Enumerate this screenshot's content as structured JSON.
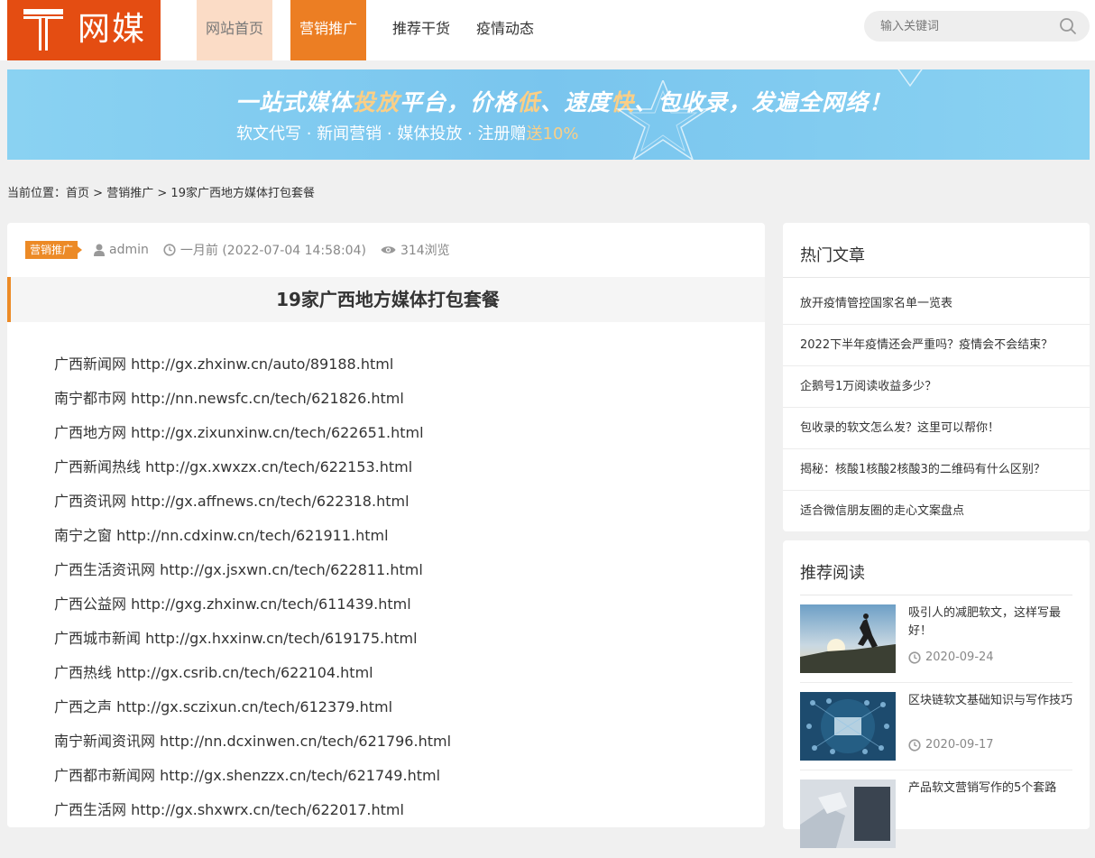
{
  "header": {
    "logo_text": "网媒",
    "nav": [
      "网站首页",
      "营销推广",
      "推荐干货",
      "疫情动态"
    ],
    "search_placeholder": "输入关键词"
  },
  "banner": {
    "title_parts": [
      "一站式媒体",
      "投放",
      "平台，价格",
      "低",
      "、速度",
      "快",
      "、包收录，发遍全网络！"
    ],
    "subtitle_main": "软文代写 · 新闻营销  · 媒体投放  ·  注册赠",
    "subtitle_highlight": "送10%"
  },
  "breadcrumb": {
    "label": "当前位置：",
    "home": "首页",
    "sep": ">",
    "category": "营销推广",
    "current": "19家广西地方媒体打包套餐"
  },
  "article": {
    "tag": "营销推广",
    "author": "admin",
    "time": "一月前 (2022-07-04 14:58:04)",
    "views": "314浏览",
    "title": "19家广西地方媒体打包套餐",
    "lines": [
      "广西新闻网 http://gx.zhxinw.cn/auto/89188.html",
      "南宁都市网 http://nn.newsfc.cn/tech/621826.html",
      "广西地方网 http://gx.zixunxinw.cn/tech/622651.html",
      "广西新闻热线 http://gx.xwxzx.cn/tech/622153.html",
      "广西资讯网 http://gx.affnews.cn/tech/622318.html",
      "南宁之窗 http://nn.cdxinw.cn/tech/621911.html",
      "广西生活资讯网 http://gx.jsxwn.cn/tech/622811.html",
      "广西公益网 http://gxg.zhxinw.cn/tech/611439.html",
      "广西城市新闻 http://gx.hxxinw.cn/tech/619175.html",
      "广西热线 http://gx.csrib.cn/tech/622104.html",
      "广西之声 http://gx.sczixun.cn/tech/612379.html",
      "南宁新闻资讯网 http://nn.dcxinwen.cn/tech/621796.html",
      "广西都市新闻网 http://gx.shenzzx.cn/tech/621749.html",
      "广西生活网 http://gx.shxwrx.cn/tech/622017.html"
    ]
  },
  "sidebar": {
    "hot_title": "热门文章",
    "hot_items": [
      "放开疫情管控国家名单一览表",
      "2022下半年疫情还会严重吗？疫情会不会结束？",
      "企鹅号1万阅读收益多少？",
      "包收录的软文怎么发？这里可以帮你！",
      "揭秘：核酸1核酸2核酸3的二维码有什么区别？",
      "适合微信朋友圈的走心文案盘点"
    ],
    "rec_title": "推荐阅读",
    "rec_items": [
      {
        "title": "吸引人的减肥软文，这样写最好！",
        "date": "2020-09-24"
      },
      {
        "title": "区块链软文基础知识与写作技巧",
        "date": "2020-09-17"
      },
      {
        "title": "产品软文营销写作的5个套路",
        "date": ""
      }
    ]
  }
}
